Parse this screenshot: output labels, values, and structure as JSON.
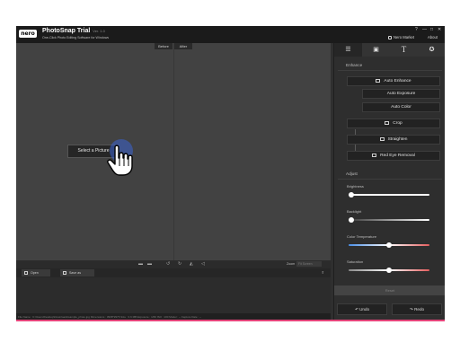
{
  "window": {
    "app_title": "PhotoSnap Trial",
    "version": "Ver. 1.0",
    "subtitle": "One-Click Photo Editing Software for Windows",
    "nero_market": "Nero Market",
    "about": "About",
    "controls": [
      "?",
      "—",
      "□",
      "✕"
    ]
  },
  "canvas": {
    "before_label": "Before",
    "after_label": "After",
    "select_picture": "Select a Picture"
  },
  "toolbar": {
    "zoom_label": "Zoom",
    "zoom_value": "Fit Screen"
  },
  "bottom": {
    "open_label": "Open",
    "save_as_label": "Save as"
  },
  "status_text": "File Name : C:\\Users\\Desktop\\Downloads\\sample_photo.jpg  Dimensions : 3968*2976  Size : 3.6 MB  Exposure : 1/60  ISO : 100  Model : --  Capture Date : --",
  "panel": {
    "tabs": [
      "adjust-tab",
      "image-tab",
      "text-tab",
      "effects-tab"
    ],
    "enhance_heading": "Enhance",
    "auto_enhance": "Auto Enhance",
    "auto_exposure": "Auto Exposure",
    "auto_color": "Auto Color",
    "crop": "Crop",
    "straighten": "Straighten",
    "red_eye": "Red Eye Removal",
    "adjust_heading": "Adjust",
    "sliders": [
      {
        "label": "Brightness",
        "value": 0.03,
        "gradient": "linear-gradient(90deg,#ffffff 0%,#ffffff 100%)"
      },
      {
        "label": "Backlight",
        "value": 0.03,
        "gradient": "linear-gradient(90deg,#3a3a3a 0%,#ffffff 100%)"
      },
      {
        "label": "Color Temperature",
        "value": 0.5,
        "gradient": "linear-gradient(90deg,#4a8fe8 0%,#ffffff 50%,#e35d5d 100%)"
      },
      {
        "label": "Saturation",
        "value": 0.5,
        "gradient": "linear-gradient(90deg,#8a8a8a 0%,#ffffff 50%,#e35d5d 100%)"
      }
    ],
    "reset": "Reset",
    "undo": "Undo",
    "redo": "Redo"
  },
  "colors": {
    "accent_pink": "#e4447a",
    "click_highlight": "#3c64d2"
  }
}
